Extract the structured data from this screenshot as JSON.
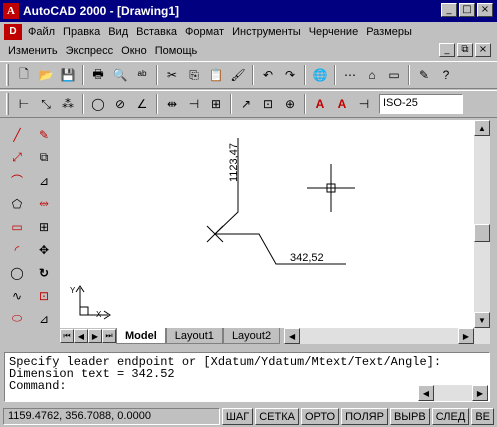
{
  "window": {
    "title": "AutoCAD 2000 - [Drawing1]",
    "app_icon": "A",
    "controls": [
      "_",
      "□",
      "×"
    ]
  },
  "menu": {
    "row1": [
      "Файл",
      "Правка",
      "Вид",
      "Вставка",
      "Формат",
      "Инструменты",
      "Черчение",
      "Размеры"
    ],
    "row2": [
      "Изменить",
      "Экспресс",
      "Окно",
      "Помощь"
    ],
    "mdi_controls": [
      "_",
      "⧉",
      "×"
    ]
  },
  "standard_toolbar": {
    "icons": [
      "new-icon",
      "open-icon",
      "save-icon",
      "print-icon",
      "preview-icon",
      "spellcheck-icon",
      "cut-icon",
      "copy-icon",
      "paste-icon",
      "match-properties-icon",
      "undo-icon",
      "redo-icon",
      "globe-icon",
      "distance-icon",
      "snap-icon",
      "layer-icon",
      "pencil-icon",
      "help-icon"
    ],
    "glyphs": [
      "🗋",
      "📂",
      "💾",
      "🖶",
      "🔍",
      "ᵃᵇ",
      "✂",
      "⎘",
      "📋",
      "🖌",
      "↶",
      "↷",
      "🌐",
      "⋯",
      "⌂",
      "▭",
      "✎",
      "?"
    ]
  },
  "dimension_toolbar": {
    "icons": [
      "linear-dim-icon",
      "aligned-dim-icon",
      "ordinate-dim-icon",
      "radius-dim-icon",
      "diameter-dim-icon",
      "angular-dim-icon",
      "quick-dim-icon",
      "baseline-dim-icon",
      "continue-dim-icon",
      "leader-icon",
      "tolerance-icon",
      "center-mark-icon",
      "dim-edit-icon",
      "dim-text-edit-icon",
      "dim-update-icon"
    ],
    "glyphs": [
      "⊢",
      "⤡",
      "⁂",
      "◯",
      "⊘",
      "∠",
      "⇹",
      "⊣",
      "⊞",
      "↗",
      "⊡",
      "⊕",
      "A",
      "A",
      "⊣"
    ],
    "dimstyle": "ISO-25"
  },
  "draw_toolbar": {
    "icons": [
      "line-icon",
      "construction-line-icon",
      "polyline-icon",
      "polygon-icon",
      "rectangle-icon",
      "arc-icon",
      "circle-icon",
      "spline-icon",
      "ellipse-icon"
    ],
    "glyphs": [
      "╱",
      "⤢",
      "⌒",
      "⬠",
      "▭",
      "◜",
      "◯",
      "∿",
      "⬭"
    ]
  },
  "modify_toolbar": {
    "icons": [
      "erase-icon",
      "copy-object-icon",
      "mirror-icon",
      "offset-icon",
      "array-icon",
      "move-icon",
      "rotate-icon",
      "scale-icon",
      "stretch-icon"
    ],
    "glyphs": [
      "✎",
      "⧉",
      "⊿",
      "⥈",
      "⊞",
      "✥",
      "↻",
      "⊡",
      "⊿"
    ]
  },
  "drawing": {
    "ordinate_y_text": "1123,47",
    "ordinate_x_text": "342,52",
    "ucs_x": "X",
    "ucs_y": "Y"
  },
  "layout_tabs": [
    "Model",
    "Layout1",
    "Layout2"
  ],
  "command": {
    "line1": "Specify leader endpoint or [Xdatum/Ydatum/Mtext/Text/Angle]:",
    "line2": "Dimension text = 342.52",
    "prompt": "Command:"
  },
  "status": {
    "coords": "1159.4762, 356.7088, 0.0000",
    "toggles": [
      "ШАГ",
      "СЕТКА",
      "ОРТО",
      "ПОЛЯР",
      "ВЫРВ",
      "СЛЕД",
      "BE"
    ]
  },
  "colors": {
    "title_bg": "#000080",
    "canvas_bg": "#ffffff",
    "chrome": "#c0c0c0"
  }
}
